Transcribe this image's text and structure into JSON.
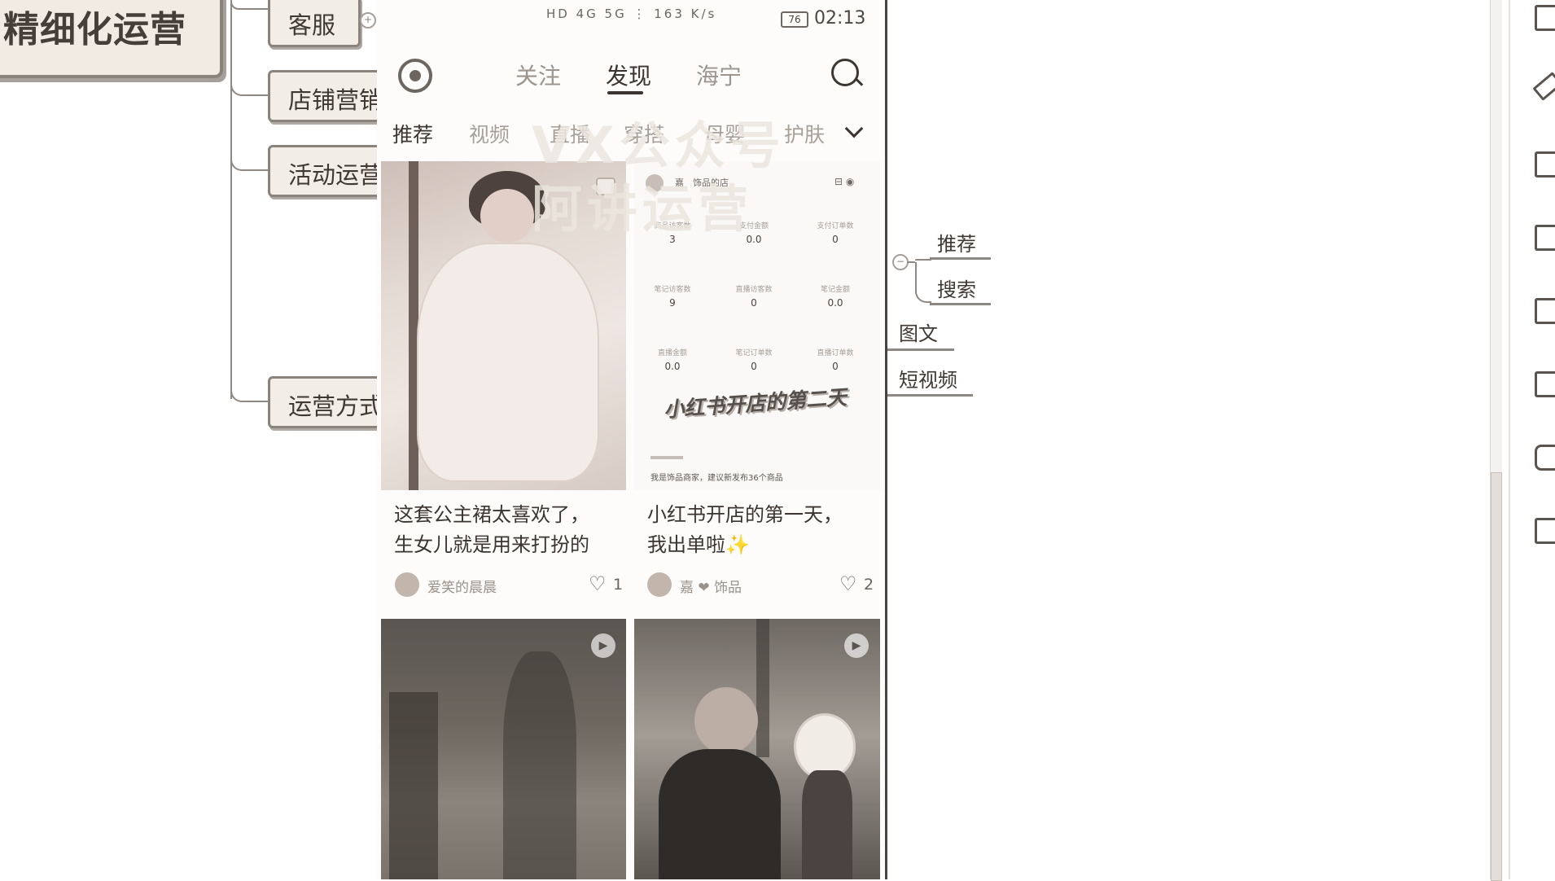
{
  "mindmap": {
    "root": "精细化运营",
    "branches": [
      "客服",
      "店铺营销",
      "活动运营",
      "运营方式"
    ],
    "collapse_symbol": "+",
    "sub_collapse_symbol": "−"
  },
  "sub_branch": {
    "items": [
      "推荐",
      "搜索",
      "图文",
      "短视频"
    ]
  },
  "phone": {
    "status": {
      "icons": "HD 4G 5G ⋮ 163 K/s",
      "battery": "76",
      "time": "02:13"
    },
    "nav": {
      "tabs": [
        "关注",
        "发现",
        "海宁"
      ],
      "active": "发现"
    },
    "categories": [
      "推荐",
      "视频",
      "直播",
      "穿搭",
      "母婴",
      "护肤"
    ],
    "watermark": "VX公众号\n阿讲运营",
    "cards": [
      {
        "title_line1": "这套公主裙太喜欢了，",
        "title_line2": "生女儿就是用来打扮的",
        "author": "爱笑的晨晨",
        "likes": "1"
      },
      {
        "title_line1": "小红书开店的第一天，",
        "title_line2": "我出单啦✨",
        "author": "嘉 ❤ 饰品",
        "likes": "2",
        "shop": {
          "name": "嘉　饰品的店",
          "stats": [
            {
              "label": "商品访客数",
              "value": "3"
            },
            {
              "label": "支付金额",
              "value": "0.0"
            },
            {
              "label": "支付订单数",
              "value": "0"
            },
            {
              "label": "笔记访客数",
              "value": "9"
            },
            {
              "label": "直播访客数",
              "value": "0"
            },
            {
              "label": "笔记金额",
              "value": "0.0"
            },
            {
              "label": "直播金额",
              "value": "0.0"
            },
            {
              "label": "笔记订单数",
              "value": "0"
            },
            {
              "label": "直播订单数",
              "value": "0"
            }
          ],
          "banner": "小红书开店的第二天",
          "note": "我是饰品商家，建议新发布36个商品"
        }
      }
    ],
    "heart": "♡",
    "play": "▶"
  },
  "toolbar": {
    "icons": [
      "outline-icon",
      "brush-icon",
      "image-icon",
      "flag-icon",
      "text-style-icon",
      "note-icon",
      "comment-icon",
      "task-icon"
    ]
  }
}
